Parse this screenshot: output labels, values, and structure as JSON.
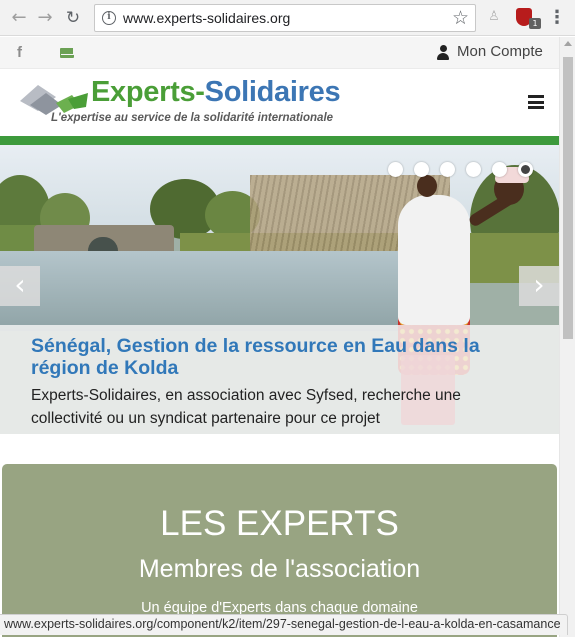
{
  "browser": {
    "url": "www.experts-solidaires.org",
    "status_url": "www.experts-solidaires.org/component/k2/item/297-senegal-gestion-de-l-eau-a-kolda-en-casamance",
    "extension_badge": "1"
  },
  "topbar": {
    "account_label": "Mon Compte"
  },
  "header": {
    "logo_name_part1": "Experts-",
    "logo_name_part2": "Solidaires",
    "logo_tagline": "L'expertise au service de la solidarité internationale"
  },
  "slider": {
    "title": "Sénégal, Gestion de la ressource en Eau dans la région de Kolda",
    "text": "Experts-Solidaires, en association avec Syfsed, recherche une collectivité ou un syndicat partenaire pour ce projet",
    "prev_label": "‹",
    "next_label": "›",
    "slide_count": 6,
    "active_slide": 6
  },
  "experts": {
    "title": "LES EXPERTS",
    "subtitle": "Membres de l'association",
    "teaser": "Un équipe d'Experts dans chaque domaine"
  },
  "colors": {
    "brand_green": "#4a9e37",
    "brand_blue": "#3c76b4",
    "caption_title_blue": "#3178b9",
    "strip_green": "#3d9a3c",
    "panel_green": "#98a482"
  },
  "icons": [
    "back-arrow-icon",
    "forward-arrow-icon",
    "reload-icon",
    "info-icon",
    "star-icon",
    "facebook-icon",
    "mail-icon",
    "user-icon",
    "hamburger-icon",
    "menu-dots-icon"
  ]
}
